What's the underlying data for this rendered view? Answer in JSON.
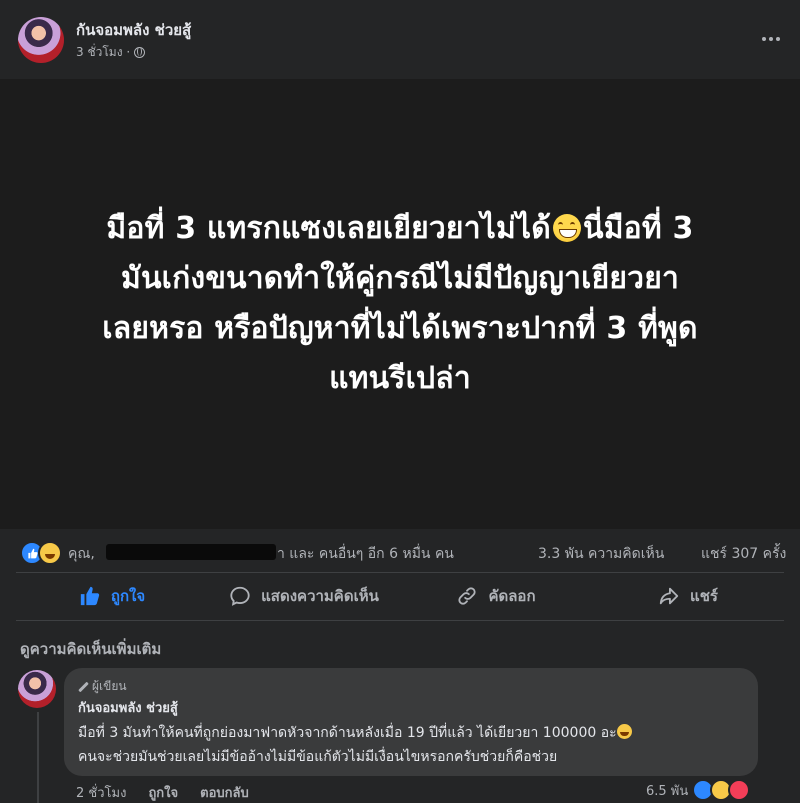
{
  "post": {
    "author": "กันจอมพลัง ช่วยสู้",
    "time": "3 ชั่วโมง ·",
    "text_lines": [
      "มือที่ 3 แทรกแซงเลยเยียวยาไม่ได้",
      "นี่มือที่ 3",
      "มันเก่งขนาดทำให้คู่กรณีไม่มีปัญญาเยียวยา",
      "เลยหรอ หรือปัญหาที่ไม่ได้เพราะปากที่ 3 ที่พูด",
      "แทนรีเปล่า"
    ],
    "reactions_prefix": "คุณ,",
    "reactions_suffix": "า และ คนอื่นๆ อีก 6 หมื่น คน",
    "comments_count": "3.3 พัน ความคิดเห็น",
    "shares_count": "แชร์ 307 ครั้ง"
  },
  "actions": {
    "like": "ถูกใจ",
    "comment": "แสดงความคิดเห็น",
    "copy": "คัดลอก",
    "share": "แชร์"
  },
  "comments_section": {
    "more_label": "ดูความคิดเห็นเพิ่มเติม"
  },
  "comment": {
    "badge": "ผู้เขียน",
    "author": "กันจอมพลัง ช่วยสู้",
    "line1": "มือที่ 3 มันทำให้คนที่ถูกย่องมาฟาดหัวจากด้านหลังเมื่อ 19 ปีที่แล้ว ได้เยียวยา 100000 อะ",
    "line2": "คนจะช่วยมันช่วยเลยไม่มีข้ออ้างไม่มีข้อแก้ตัวไม่มีเงื่อนไขหรอกครับช่วยก็คือช่วย",
    "time": "2 ชั่วโมง",
    "like": "ถูกใจ",
    "reply": "ตอบกลับ",
    "reactions_count": "6.5 พัน"
  },
  "colors": {
    "background": "#242526",
    "canvas": "#1c1c1c",
    "accent": "#2d88ff",
    "secondary_text": "#b0b3b8"
  }
}
